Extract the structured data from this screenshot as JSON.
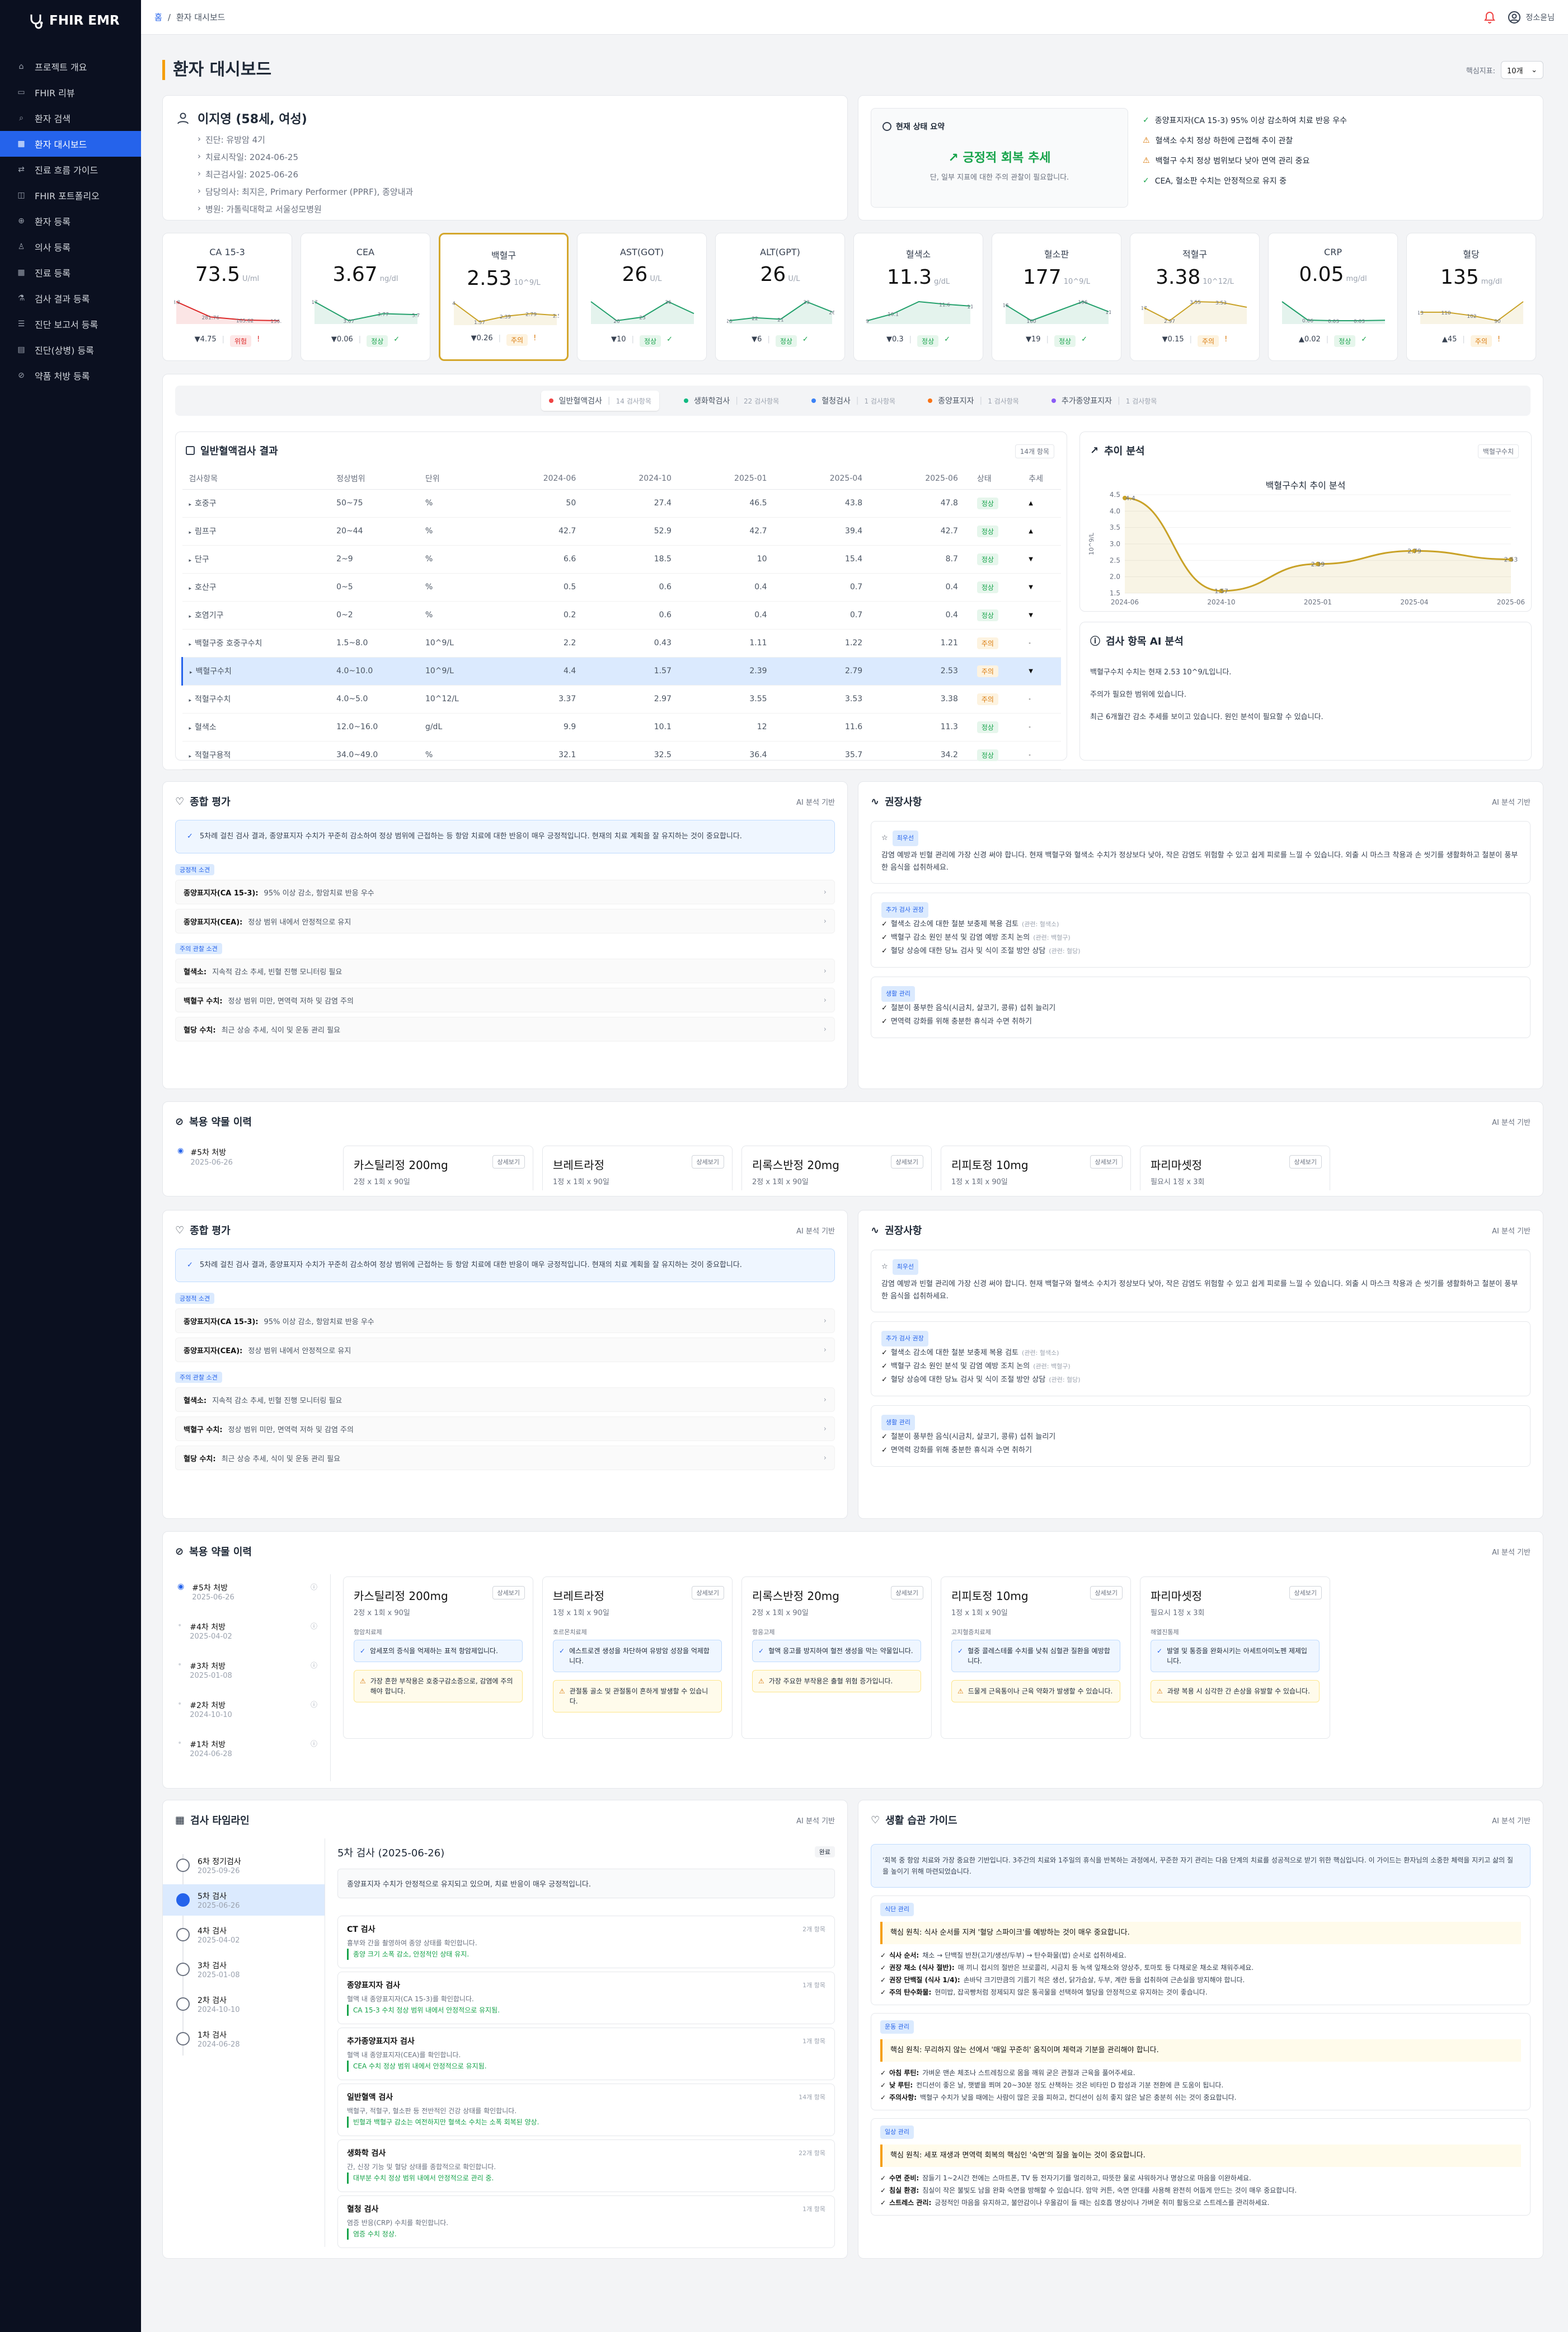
{
  "app": {
    "logo": "FHIR EMR"
  },
  "sidebar": {
    "items": [
      {
        "label": "프로젝트 개요",
        "icon": "home-icon"
      },
      {
        "label": "FHIR 리뷰",
        "icon": "document-icon"
      },
      {
        "label": "환자 검색",
        "icon": "search-icon"
      },
      {
        "label": "환자 대시보드",
        "icon": "dashboard-icon",
        "active": true
      },
      {
        "label": "진료 흐름 가이드",
        "icon": "flow-icon"
      },
      {
        "label": "FHIR 포트폴리오",
        "icon": "portfolio-icon"
      },
      {
        "label": "환자 등록",
        "icon": "user-plus-icon"
      },
      {
        "label": "의사 등록",
        "icon": "doctor-icon"
      },
      {
        "label": "진료 등록",
        "icon": "calendar-icon"
      },
      {
        "label": "검사 결과 등록",
        "icon": "flask-icon"
      },
      {
        "label": "진단 보고서 등록",
        "icon": "report-icon"
      },
      {
        "label": "진단(상병) 등록",
        "icon": "clipboard-icon"
      },
      {
        "label": "약품 처방 등록",
        "icon": "pill-icon"
      }
    ]
  },
  "topbar": {
    "breadcrumb_home": "홈",
    "breadcrumb_sep": "/",
    "breadcrumb_current": "환자 대시보드",
    "user": "정소윤님"
  },
  "page": {
    "title": "환자 대시보드",
    "select_label": "핵심지표:",
    "select_value": "10개"
  },
  "patient": {
    "name": "이지영 (58세, 여성)",
    "lines": [
      "진단: 유방암 4기",
      "치료시작일: 2024-06-25",
      "최근검사일: 2025-06-26",
      "담당의사: 최지은, Primary Performer (PPRF), 종양내과",
      "병원: 가톨릭대학교 서울성모병원"
    ]
  },
  "status": {
    "heading": "현재 상태 요약",
    "trend": "긍정적 회복 추세",
    "note": "단, 일부 지표에 대한 주의 관찰이 필요합니다.",
    "points": [
      {
        "text": "종양표지자(CA 15-3) 95% 이상 감소하여 치료 반응 우수",
        "level": "ok"
      },
      {
        "text": "혈색소 수치 정상 하한에 근접해 추이 관찰",
        "level": "warn"
      },
      {
        "text": "백혈구 수치 정상 범위보다 낮아 면역 관리 중요",
        "level": "warn"
      },
      {
        "text": "CEA, 혈소판 수치는 안정적으로 유지 중",
        "level": "ok"
      }
    ]
  },
  "kpis": [
    {
      "name": "CA 15-3",
      "value": "73.5",
      "unit": "U/ml",
      "delta": "▼4.75",
      "status": "위험",
      "level": "bad",
      "spark": [
        [
          0,
          8
        ],
        [
          1,
          3
        ],
        [
          2,
          2
        ],
        [
          3,
          1.8
        ]
      ],
      "labels": [
        "8.8",
        "281.76",
        "165.62",
        "156.28"
      ]
    },
    {
      "name": "CEA",
      "value": "3.67",
      "unit": "ng/dl",
      "delta": "▼0.06",
      "status": "정상",
      "level": "ok",
      "spark": [
        [
          0,
          5
        ],
        [
          1,
          3.1
        ],
        [
          2,
          3.8
        ],
        [
          3,
          3.7
        ]
      ],
      "labels": [
        "17",
        "3.07",
        "3.77",
        "3.73"
      ]
    },
    {
      "name": "백혈구",
      "value": "2.53",
      "unit": "10^9/L",
      "delta": "▼0.26",
      "status": "주의",
      "level": "warn",
      "spark": [
        [
          0,
          4.4
        ],
        [
          1,
          1.57
        ],
        [
          2,
          2.39
        ],
        [
          3,
          2.79
        ],
        [
          4,
          2.53
        ]
      ],
      "labels": [
        "4",
        "1.57",
        "2.39",
        "2.79",
        "2.5"
      ],
      "selected": true
    },
    {
      "name": "AST(GOT)",
      "value": "26",
      "unit": "U/L",
      "delta": "▼10",
      "status": "정상",
      "level": "ok",
      "spark": [
        [
          0,
          36
        ],
        [
          1,
          20
        ],
        [
          2,
          23
        ],
        [
          3,
          36
        ],
        [
          4,
          26
        ]
      ],
      "labels": [
        "",
        "20",
        "23",
        "36",
        ""
      ]
    },
    {
      "name": "ALT(GPT)",
      "value": "26",
      "unit": "U/L",
      "delta": "▼6",
      "status": "정상",
      "level": "ok",
      "spark": [
        [
          0,
          20
        ],
        [
          1,
          22
        ],
        [
          2,
          21
        ],
        [
          3,
          33
        ],
        [
          4,
          26
        ]
      ],
      "labels": [
        "20",
        "22",
        "21",
        "33",
        "26"
      ]
    },
    {
      "name": "혈색소",
      "value": "11.3",
      "unit": "g/dL",
      "delta": "▼0.3",
      "status": "정상",
      "level": "ok",
      "spark": [
        [
          0,
          9
        ],
        [
          1,
          10.1
        ],
        [
          2,
          12
        ],
        [
          3,
          11.6
        ],
        [
          4,
          11.3
        ]
      ],
      "labels": [
        "9",
        "10.1",
        "",
        "11.6",
        "11"
      ]
    },
    {
      "name": "혈소판",
      "value": "177",
      "unit": "10^9/L",
      "delta": "▼19",
      "status": "정상",
      "level": "ok",
      "spark": [
        [
          0,
          190
        ],
        [
          1,
          160
        ],
        [
          2,
          178
        ],
        [
          3,
          196
        ],
        [
          4,
          177
        ]
      ],
      "labels": [
        "16",
        "160",
        "",
        "196",
        "11"
      ]
    },
    {
      "name": "적혈구",
      "value": "3.38",
      "unit": "10^12/L",
      "delta": "▼0.15",
      "status": "주의",
      "level": "warn",
      "spark": [
        [
          0,
          3.37
        ],
        [
          1,
          2.97
        ],
        [
          2,
          3.55
        ],
        [
          3,
          3.53
        ],
        [
          4,
          3.38
        ]
      ],
      "labels": [
        "17",
        "2.97",
        "3.55",
        "3.53",
        ""
      ]
    },
    {
      "name": "CRP",
      "value": "0.05",
      "unit": "mg/dl",
      "delta": "▲0.02",
      "status": "정상",
      "level": "ok",
      "spark": [
        [
          0,
          1
        ],
        [
          1,
          0.06
        ],
        [
          2,
          0.03
        ],
        [
          3,
          0.03
        ],
        [
          4,
          0.05
        ]
      ],
      "labels": [
        "",
        "0.06",
        "0.03",
        "0.03",
        ""
      ]
    },
    {
      "name": "혈당",
      "value": "135",
      "unit": "mg/dl",
      "delta": "▲45",
      "status": "주의",
      "level": "warn",
      "spark": [
        [
          0,
          110
        ],
        [
          1,
          110
        ],
        [
          2,
          102
        ],
        [
          3,
          90
        ],
        [
          4,
          135
        ]
      ],
      "labels": [
        "13",
        "110",
        "102",
        "90",
        ""
      ]
    }
  ],
  "tabs": [
    {
      "label": "일반혈액검사",
      "count": "14 검사항목",
      "color": "#ef4444",
      "active": true
    },
    {
      "label": "생화학검사",
      "count": "22 검사항목",
      "color": "#10b981"
    },
    {
      "label": "혈청검사",
      "count": "1 검사항목",
      "color": "#3b82f6"
    },
    {
      "label": "종양표지자",
      "count": "1 검사항목",
      "color": "#f97316"
    },
    {
      "label": "추가종양표지자",
      "count": "1 검사항목",
      "color": "#8b5cf6"
    }
  ],
  "lab": {
    "title": "일반혈액검사 결과",
    "count": "14개 항목",
    "headers": [
      "검사항목",
      "정상범위",
      "단위",
      "2024-06",
      "2024-10",
      "2025-01",
      "2025-04",
      "2025-06",
      "상태",
      "추세"
    ],
    "rows": [
      {
        "name": "호중구",
        "range": "50~75",
        "unit": "%",
        "v": [
          "50",
          "27.4",
          "46.5",
          "43.8",
          "47.8"
        ],
        "status": "정상",
        "trend": "▲"
      },
      {
        "name": "림프구",
        "range": "20~44",
        "unit": "%",
        "v": [
          "42.7",
          "52.9",
          "42.7",
          "39.4",
          "42.7"
        ],
        "status": "정상",
        "trend": "▲"
      },
      {
        "name": "단구",
        "range": "2~9",
        "unit": "%",
        "v": [
          "6.6",
          "18.5",
          "10",
          "15.4",
          "8.7"
        ],
        "status": "정상",
        "trend": "▼"
      },
      {
        "name": "호산구",
        "range": "0~5",
        "unit": "%",
        "v": [
          "0.5",
          "0.6",
          "0.4",
          "0.7",
          "0.4"
        ],
        "status": "정상",
        "trend": "▼"
      },
      {
        "name": "호염기구",
        "range": "0~2",
        "unit": "%",
        "v": [
          "0.2",
          "0.6",
          "0.4",
          "0.7",
          "0.4"
        ],
        "status": "정상",
        "trend": "▼"
      },
      {
        "name": "백혈구중 호중구수치",
        "range": "1.5~8.0",
        "unit": "10^9/L",
        "v": [
          "2.2",
          "0.43",
          "1.11",
          "1.22",
          "1.21"
        ],
        "status": "주의",
        "trend": "-"
      },
      {
        "name": "백혈구수치",
        "range": "4.0~10.0",
        "unit": "10^9/L",
        "v": [
          "4.4",
          "1.57",
          "2.39",
          "2.79",
          "2.53"
        ],
        "status": "주의",
        "trend": "▼",
        "highlight": true
      },
      {
        "name": "적혈구수치",
        "range": "4.0~5.0",
        "unit": "10^12/L",
        "v": [
          "3.37",
          "2.97",
          "3.55",
          "3.53",
          "3.38"
        ],
        "status": "주의",
        "trend": "-"
      },
      {
        "name": "혈색소",
        "range": "12.0~16.0",
        "unit": "g/dL",
        "v": [
          "9.9",
          "10.1",
          "12",
          "11.6",
          "11.3"
        ],
        "status": "정상",
        "trend": "-"
      },
      {
        "name": "적혈구용적",
        "range": "34.0~49.0",
        "unit": "%",
        "v": [
          "32.1",
          "32.5",
          "36.4",
          "35.7",
          "34.2"
        ],
        "status": "정상",
        "trend": "-"
      }
    ]
  },
  "trend": {
    "title": "추이 분석",
    "tag": "백혈구수치",
    "chart_title": "백혈구수치 추이 분석"
  },
  "chart_data": {
    "type": "line",
    "title": "백혈구수치 추이 분석",
    "categories": [
      "2024-06",
      "2024-10",
      "2025-01",
      "2025-04",
      "2025-06"
    ],
    "values": [
      4.4,
      1.57,
      2.39,
      2.79,
      2.53
    ],
    "ylabel": "10^9/L",
    "ylim": [
      1.5,
      4.5
    ],
    "yticks": [
      "1.5",
      "2.0",
      "2.5",
      "3.0",
      "3.5",
      "4.0",
      "4.5"
    ],
    "point_labels": [
      "4.4",
      "1.57",
      "2.39",
      "2.79",
      "2.53"
    ],
    "color": "#c9a227"
  },
  "ai_analysis": {
    "title": "검사 항목 AI 분석",
    "lines": [
      "백혈구수치 수치는 현재 2.53 10^9/L입니다.",
      "주의가 필요한 범위에 있습니다.",
      "최근 6개월간 감소 추세를 보이고 있습니다. 원인 분석이 필요할 수 있습니다."
    ]
  },
  "assessment": {
    "title": "종합 평가",
    "ai": "AI 분석 기반",
    "summary": "5차례 걸친 검사 결과, 종양표지자 수치가 꾸준히 감소하여 정상 범위에 근접하는 등 항암 치료에 대한 반응이 매우 긍정적입니다. 현재의 치료 계획을 잘 유지하는 것이 중요합니다.",
    "pos_tag": "긍정적 소견",
    "pos": [
      {
        "k": "종양표지자(CA 15-3):",
        "v": "95% 이상 감소, 항암치료 반응 우수"
      },
      {
        "k": "종양표지자(CEA):",
        "v": "정상 범위 내에서 안정적으로 유지"
      }
    ],
    "warn_tag": "주의 관찰 소견",
    "warn": [
      {
        "k": "혈색소:",
        "v": "지속적 감소 추세, 빈혈 진행 모니터링 필요"
      },
      {
        "k": "백혈구 수치:",
        "v": "정상 범위 미만, 면역력 저하 및 감염 주의"
      },
      {
        "k": "혈당 수치:",
        "v": "최근 상승 추세, 식이 및 운동 관리 필요"
      }
    ]
  },
  "recommend": {
    "title": "권장사항",
    "ai": "AI 분석 기반",
    "prio_tag": "최우선",
    "prio_text": "감염 예방과 빈혈 관리에 가장 신경 써야 합니다. 현재 백혈구와 혈색소 수치가 정상보다 낮아, 작은 감염도 위험할 수 있고 쉽게 피로를 느낄 수 있습니다. 외출 시 마스크 착용과 손 씻기를 생활화하고 철분이 풍부한 음식을 섭취하세요.",
    "follow_tag": "추가 검사 권장",
    "follow": [
      {
        "t": "혈색소 감소에 대한 철분 보충제 복용 검토",
        "s": "(관련: 혈색소)"
      },
      {
        "t": "백혈구 감소 원인 분석 및 감염 예방 조치 논의",
        "s": "(관련: 백혈구)"
      },
      {
        "t": "혈당 상승에 대한 당뇨 검사 및 식이 조절 방안 상담",
        "s": "(관련: 혈당)"
      }
    ],
    "life_tag": "생활 관리",
    "life": [
      "철분이 풍부한 음식(시금치, 살코기, 콩류) 섭취 늘리기",
      "면역력 강화를 위해 충분한 휴식과 수면 취하기"
    ]
  },
  "meds": {
    "title": "복용 약물 이력",
    "ai": "AI 분석 기반",
    "rx": [
      {
        "label": "#5차 처방",
        "date": "2025-06-26",
        "active": true
      },
      {
        "label": "#4차 처방",
        "date": "2025-04-02"
      },
      {
        "label": "#3차 처방",
        "date": "2025-01-08"
      },
      {
        "label": "#2차 처방",
        "date": "2024-10-10"
      },
      {
        "label": "#1차 처방",
        "date": "2024-06-28"
      }
    ],
    "detail_btn": "상세보기",
    "items": [
      {
        "name": "카스틸리정 200mg",
        "dose": "2정 x 1회 x 90일",
        "cat": "항암치료제",
        "info": "암세포의 증식을 억제하는 표적 항암제입니다.",
        "warn": "가장 흔한 부작용은 호중구감소증으로, 감염에 주의해야 합니다."
      },
      {
        "name": "브레트라정",
        "dose": "1정 x 1회 x 90일",
        "cat": "호르몬치료제",
        "info": "에스트로겐 생성을 차단하여 유방암 성장을 억제합니다.",
        "warn": "관절통 골소 및 관절통이 흔하게 발생할 수 있습니다."
      },
      {
        "name": "리록스반정 20mg",
        "dose": "2정 x 1회 x 90일",
        "cat": "항응고제",
        "info": "혈액 응고를 방지하여 혈전 생성을 막는 약물입니다.",
        "warn": "가장 주요한 부작용은 출혈 위험 증가입니다."
      },
      {
        "name": "리피토정 10mg",
        "dose": "1정 x 1회 x 90일",
        "cat": "고지혈증치료제",
        "info": "혈중 콜레스테롤 수치를 낮춰 심혈관 질환을 예방합니다.",
        "warn": "드물게 근육통이나 근육 약화가 발생할 수 있습니다."
      },
      {
        "name": "파리마셋정",
        "dose": "필요시 1정 x 3회",
        "cat": "해열진통제",
        "info": "발열 및 통증을 완화시키는 아세트아미노펜 제제입니다.",
        "warn": "과량 복용 시 심각한 간 손상을 유발할 수 있습니다."
      }
    ]
  },
  "timeline": {
    "title": "검사 타임라인",
    "ai": "AI 분석 기반",
    "items": [
      {
        "label": "6차 정기검사",
        "date": "2025-09-26"
      },
      {
        "label": "5차 검사",
        "date": "2025-06-26",
        "active": true
      },
      {
        "label": "4차 검사",
        "date": "2025-04-02"
      },
      {
        "label": "3차 검사",
        "date": "2025-01-08"
      },
      {
        "label": "2차 검사",
        "date": "2024-10-10"
      },
      {
        "label": "1차 검사",
        "date": "2024-06-28"
      }
    ],
    "detail_title": "5차 검사 (2025-06-26)",
    "detail_badge": "완료",
    "detail_summary": "종양표지자 수치가 안정적으로 유지되고 있으며, 치료 반응이 매우 긍정적입니다.",
    "exams": [
      {
        "name": "CT 검사",
        "count": "2개 항목",
        "desc": "흉부와 간을 촬영하여 종양 상태를 확인합니다.",
        "note": "종양 크기 소폭 감소, 안정적인 상태 유지."
      },
      {
        "name": "종양표지자 검사",
        "count": "1개 항목",
        "desc": "혈액 내 종양표지자(CA 15-3)를 확인합니다.",
        "note": "CA 15-3 수치 정상 범위 내에서 안정적으로 유지됨."
      },
      {
        "name": "추가종양표지자 검사",
        "count": "1개 항목",
        "desc": "혈액 내 종양표지자(CEA)를 확인합니다.",
        "note": "CEA 수치 정상 범위 내에서 안정적으로 유지됨."
      },
      {
        "name": "일반혈액 검사",
        "count": "14개 항목",
        "desc": "백혈구, 적혈구, 혈소판 등 전반적인 건강 상태를 확인합니다.",
        "note": "빈혈과 백혈구 감소는 여전하지만 혈색소 수치는 소폭 회복된 양상."
      },
      {
        "name": "생화학 검사",
        "count": "22개 항목",
        "desc": "간, 신장 기능 및 혈당 상태를 종합적으로 확인합니다.",
        "note": "대부분 수치 정상 범위 내에서 안정적으로 관리 중."
      },
      {
        "name": "혈청 검사",
        "count": "1개 항목",
        "desc": "염증 반응(CRP) 수치를 확인합니다.",
        "note": "염증 수치 정상."
      }
    ]
  },
  "guide": {
    "title": "생활 습관 가이드",
    "ai": "AI 분석 기반",
    "intro": "'회복 중 항암 치료와 가장 중요한 기반입니다. 3주간의 치료와 1주일의 휴식을 반복하는 과정에서, 꾸준한 자기 관리는 다음 단계의 치료를 성공적으로 받기 위한 핵심입니다. 이 가이드는 환자님의 소중한 체력을 지키고 삶의 질을 높이기 위해 마련되었습니다.",
    "sections": [
      {
        "tag": "식단 관리",
        "core": "핵심 원칙: 식사 순서를 지켜 '혈당 스파이크'를 예방하는 것이 매우 중요합니다.",
        "items": [
          {
            "k": "식사 순서:",
            "v": "채소 → 단백질 반찬(고기/생선/두부) → 탄수화물(밥) 순서로 섭취하세요."
          },
          {
            "k": "권장 채소 (식사 절반):",
            "v": "매 끼니 접시의 절반은 브로콜리, 시금치 등 녹색 잎채소와 양상추, 토마토 등 다채로운 채소로 채워주세요."
          },
          {
            "k": "권장 단백질 (식사 1/4):",
            "v": "손바닥 크기만큼의 기름기 적은 생선, 닭가슴살, 두부, 계란 등을 섭취하여 근손실을 방지해야 합니다."
          },
          {
            "k": "주의 탄수화물:",
            "v": "현미밥, 잡곡빵처럼 정제되지 않은 통곡물을 선택하여 혈당을 안정적으로 유지하는 것이 좋습니다."
          }
        ]
      },
      {
        "tag": "운동 관리",
        "core": "핵심 원칙: 무리하지 않는 선에서 '매일 꾸준히' 움직이며 체력과 기분을 관리해야 합니다.",
        "items": [
          {
            "k": "아침 루틴:",
            "v": "가벼운 맨손 체조나 스트레칭으로 몸을 깨워 굳은 관절과 근육을 풀어주세요."
          },
          {
            "k": "낮 루틴:",
            "v": "컨디션이 좋은 날, 햇볕을 쬐며 20~30분 정도 산책하는 것은 비타민 D 합성과 기분 전환에 큰 도움이 됩니다."
          },
          {
            "k": "주의사항:",
            "v": "백혈구 수치가 낮을 때에는 사람이 많은 곳을 피하고, 컨디션이 심히 좋지 않은 날은 충분히 쉬는 것이 중요합니다."
          }
        ]
      },
      {
        "tag": "일상 관리",
        "core": "핵심 원칙: 세포 재생과 면역력 회복의 핵심인 '숙면'의 질을 높이는 것이 중요합니다.",
        "items": [
          {
            "k": "수면 준비:",
            "v": "잠들기 1~2시간 전에는 스마트폰, TV 등 전자기기를 멀리하고, 따뜻한 물로 샤워하거나 명상으로 마음을 이완하세요."
          },
          {
            "k": "침실 환경:",
            "v": "침실이 작은 불빛도 남을 완화 숙면을 방해할 수 있습니다. 암막 커튼, 숙면 안대를 사용해 완전히 어둡게 만드는 것이 매우 중요합니다."
          },
          {
            "k": "스트레스 관리:",
            "v": "긍정적인 마음을 유지하고, 불안감이나 우울감이 들 때는 심호흡 명상이나 가벼운 취미 활동으로 스트레스를 관리하세요."
          }
        ]
      }
    ]
  }
}
